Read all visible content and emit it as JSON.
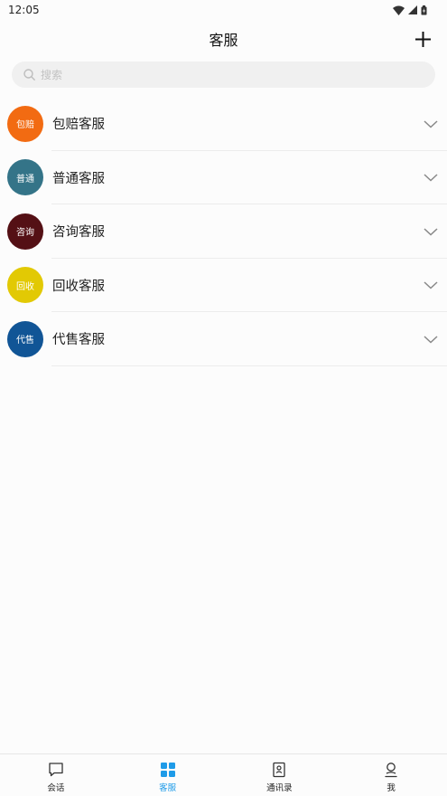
{
  "status_bar": {
    "time": "12:05"
  },
  "header": {
    "title": "客服"
  },
  "search": {
    "placeholder": "搜索"
  },
  "service_items": [
    {
      "avatar_text": "包赔",
      "label": "包赔客服",
      "color": "#f26b12"
    },
    {
      "avatar_text": "普通",
      "label": "普通客服",
      "color": "#347488"
    },
    {
      "avatar_text": "咨询",
      "label": "咨询客服",
      "color": "#541015"
    },
    {
      "avatar_text": "回收",
      "label": "回收客服",
      "color": "#e2c904"
    },
    {
      "avatar_text": "代售",
      "label": "代售客服",
      "color": "#115596"
    }
  ],
  "tabs": [
    {
      "label": "会话",
      "icon": "chat-bubble-icon",
      "active": false
    },
    {
      "label": "客服",
      "icon": "grid-icon",
      "active": true
    },
    {
      "label": "通讯录",
      "icon": "contacts-book-icon",
      "active": false
    },
    {
      "label": "我",
      "icon": "user-icon",
      "active": false
    }
  ],
  "colors": {
    "accent": "#1e9be8",
    "search_bg": "#f0f0f0",
    "divider": "#ececec"
  }
}
